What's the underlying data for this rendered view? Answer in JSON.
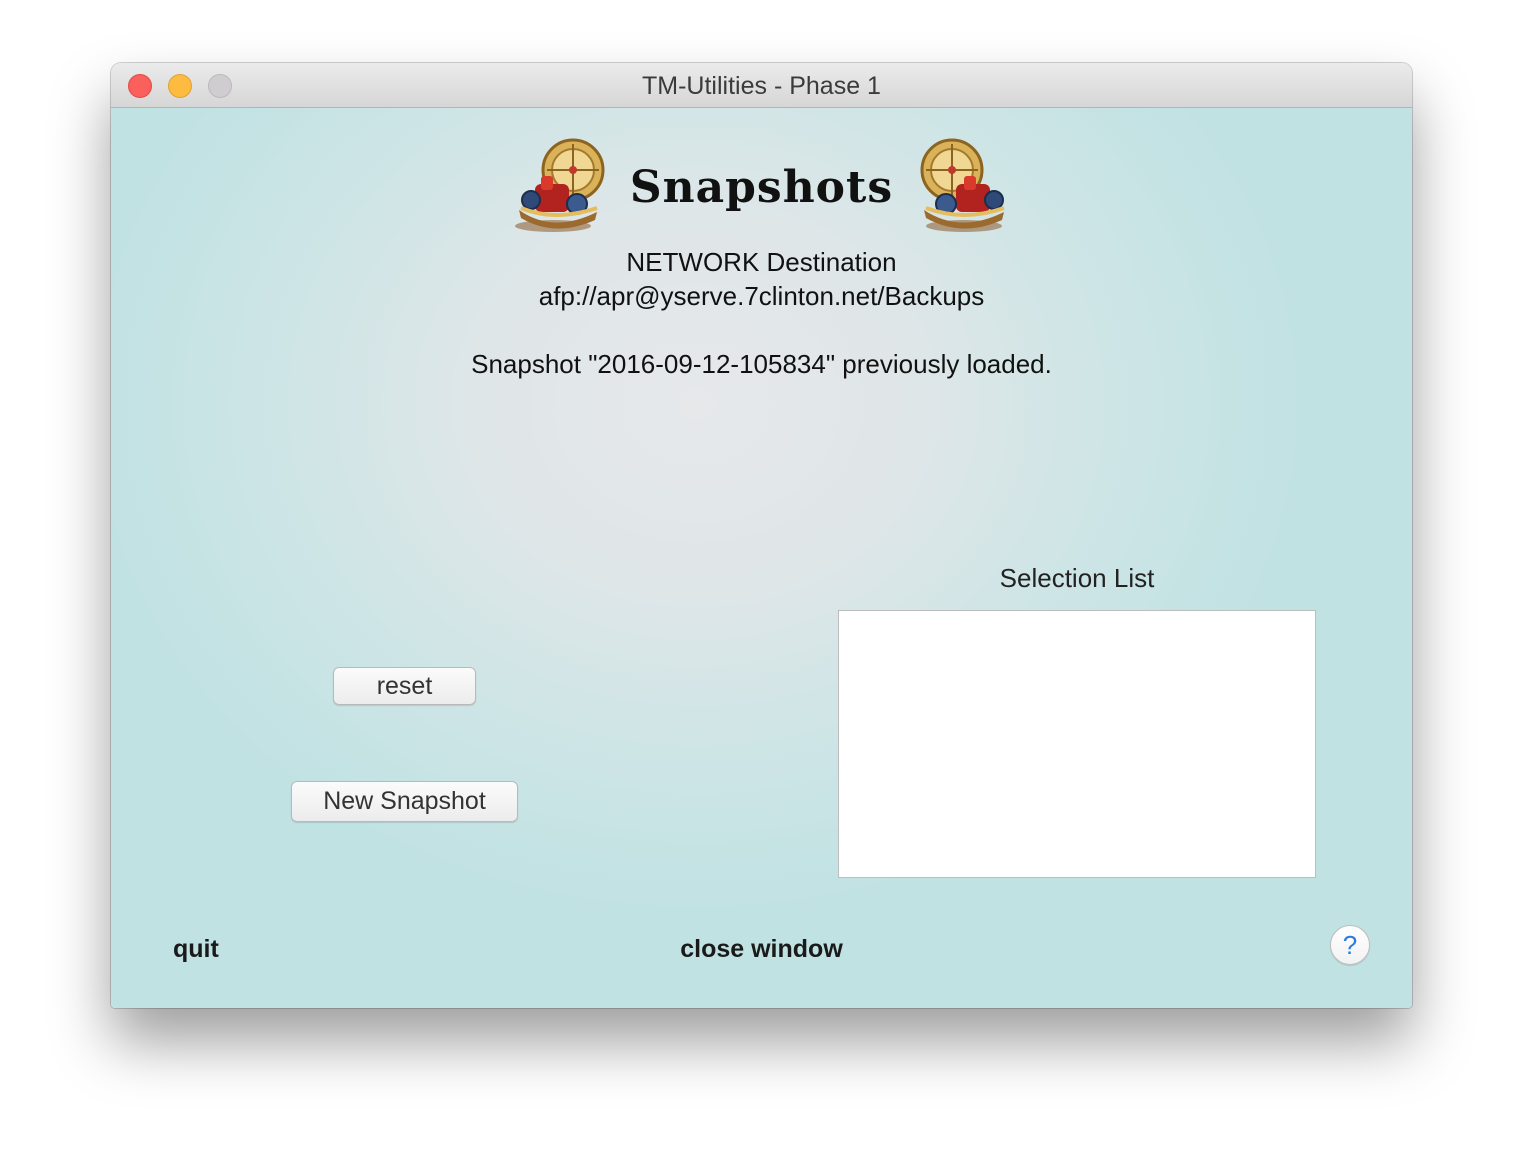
{
  "window": {
    "title": "TM-Utilities - Phase 1"
  },
  "header": {
    "title": "Snapshots",
    "icon": "time-machine-icon"
  },
  "destination": {
    "type": "NETWORK Destination",
    "url": "afp://apr@yserve.7clinton.net/Backups"
  },
  "status": {
    "message": "Snapshot \"2016-09-12-105834\" previously loaded."
  },
  "buttons": {
    "reset": "reset",
    "new_snapshot": "New Snapshot"
  },
  "selection": {
    "label": "Selection List",
    "items": []
  },
  "footer": {
    "quit": "quit",
    "close_window": "close window",
    "help": "?"
  },
  "colors": {
    "close": "#fc605c",
    "minimize": "#fdbc40",
    "zoom": "#cfcdcf",
    "background": "#c0e2e3",
    "help_accent": "#2a7ce0"
  }
}
